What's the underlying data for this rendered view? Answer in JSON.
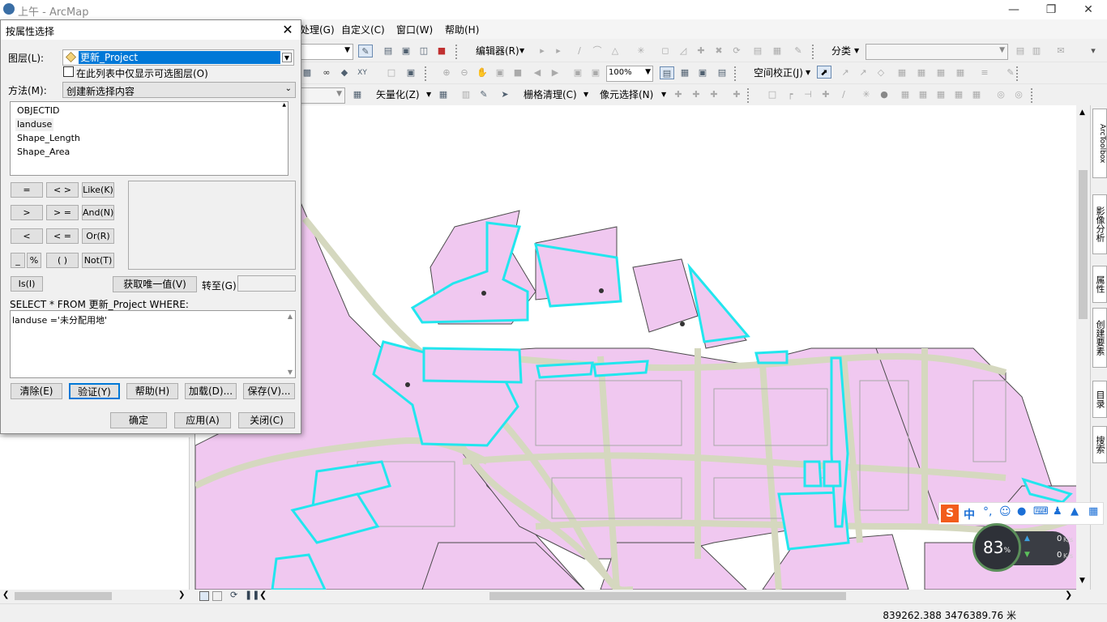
{
  "app": {
    "title": "上午 - ArcMap"
  },
  "menu": [
    "处理(G)",
    "自定义(C)",
    "窗口(W)",
    "帮助(H)"
  ],
  "toolbar": {
    "editor_label": "编辑器(R)",
    "classify_label": "分类",
    "zoom_value": "100%",
    "georef_label": "空间校正(J)",
    "vectorize_label": "矢量化(Z)",
    "raster_clean_label": "栅格清理(C)",
    "cell_select_label": "像元选择(N)"
  },
  "right_tabs": [
    "ArcToolbox",
    "影像分析",
    "属性",
    "创建要素",
    "目录",
    "搜索"
  ],
  "status": {
    "coords": "839262.388  3476389.76 米"
  },
  "dialog": {
    "title": "按属性选择",
    "layer_label": "图层(L):",
    "layer_value": "更新_Project",
    "only_selectable_label": "在此列表中仅显示可选图层(O)",
    "method_label": "方法(M):",
    "method_value": "创建新选择内容",
    "fields": [
      "OBJECTID",
      "landuse",
      "Shape_Length",
      "Shape_Area"
    ],
    "ops": {
      "eq": "=",
      "ne": "< >",
      "like": "Like(K)",
      "gt": ">",
      "ge": "> =",
      "and": "And(N)",
      "lt": "<",
      "le": "< =",
      "or": "Or(R)",
      "us": "_",
      "pct": "%",
      "paren": "( )",
      "not": "Not(T)",
      "is": "Is(I)"
    },
    "unique_button": "获取唯一值(V)",
    "goto_label": "转至(G):",
    "sql_prefix": "SELECT * FROM 更新_Project WHERE:",
    "sql_text": "landuse ='未分配用地'",
    "buttons": {
      "clear": "清除(E)",
      "verify": "验证(Y)",
      "help": "帮助(H)",
      "load": "加载(D)...",
      "save": "保存(V)...",
      "ok": "确定",
      "apply": "应用(A)",
      "close": "关闭(C)"
    }
  },
  "ime": {
    "lang": "中"
  },
  "netmon": {
    "percent": "83",
    "unit": "%",
    "up": "0",
    "down": "0",
    "rate_unit": "K/s"
  },
  "colors": {
    "parcel_fill": "#f0c8f0",
    "parcel_stroke": "#4a4a4a",
    "selected_stroke": "#22e6ee",
    "road": "#d8dcc4",
    "accent": "#0078d7"
  }
}
